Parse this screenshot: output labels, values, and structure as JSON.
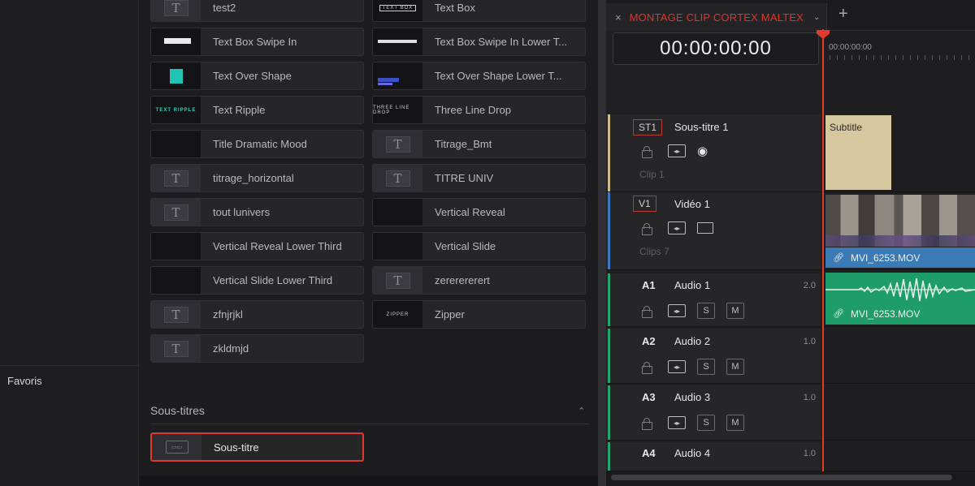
{
  "sidebar": {
    "favorites_label": "Favoris"
  },
  "library": {
    "titles_grid": [
      {
        "label": "test2",
        "thumb": "generic"
      },
      {
        "label": "Text Box",
        "thumb": "textbox",
        "thumb_text": "TEXT BOX"
      },
      {
        "label": "Text Box Swipe In",
        "thumb": "swipe"
      },
      {
        "label": "Text Box Swipe In Lower T...",
        "thumb": "swipelow"
      },
      {
        "label": "Text Over Shape",
        "thumb": "shape"
      },
      {
        "label": "Text Over Shape Lower T...",
        "thumb": "shapelow"
      },
      {
        "label": "Text Ripple",
        "thumb": "ripple",
        "thumb_text": "TEXT RIPPLE"
      },
      {
        "label": "Three Line Drop",
        "thumb": "threeline",
        "thumb_text": "THREE LINE DROP"
      },
      {
        "label": "Title Dramatic Mood",
        "thumb": "dark"
      },
      {
        "label": "Titrage_Bmt",
        "thumb": "generic"
      },
      {
        "label": "titrage_horizontal",
        "thumb": "generic"
      },
      {
        "label": "TITRE UNIV",
        "thumb": "generic"
      },
      {
        "label": "tout lunivers",
        "thumb": "generic"
      },
      {
        "label": "Vertical Reveal",
        "thumb": "dark"
      },
      {
        "label": "Vertical Reveal Lower Third",
        "thumb": "dark"
      },
      {
        "label": "Vertical Slide",
        "thumb": "dark"
      },
      {
        "label": "Vertical Slide Lower Third",
        "thumb": "dark"
      },
      {
        "label": "zererererert",
        "thumb": "generic"
      },
      {
        "label": "zfnjrjkl",
        "thumb": "generic"
      },
      {
        "label": "Zipper",
        "thumb": "zipper",
        "thumb_text": "ZIPPER"
      },
      {
        "label": "zkldmjd",
        "thumb": "generic"
      }
    ],
    "section_title": "Sous-titres",
    "section_chevron": "⌃",
    "subtitle_item": {
      "label": "Sous-titre"
    }
  },
  "timeline": {
    "tab_close": "×",
    "tab_title": "MONTAGE CLIP CORTEX MALTEX",
    "tab_chevron": "⌄",
    "tab_add": "+",
    "timecode": "00:00:00:00",
    "ruler_time": "00:00:00:00",
    "tracks": [
      {
        "id": "ST1",
        "name": "Sous-titre 1",
        "meta": "Clip 1",
        "color": "#cdbb8f"
      },
      {
        "id": "V1",
        "name": "Vidéo 1",
        "meta": "Clips 7",
        "color": "#3b78c2"
      },
      {
        "id": "A1",
        "name": "Audio 1",
        "vol": "2.0",
        "color": "#22a56e"
      },
      {
        "id": "A2",
        "name": "Audio 2",
        "vol": "1.0",
        "color": "#22a56e"
      },
      {
        "id": "A3",
        "name": "Audio 3",
        "vol": "1.0",
        "color": "#22a56e"
      },
      {
        "id": "A4",
        "name": "Audio 4",
        "vol": "1.0",
        "color": "#22a56e"
      }
    ],
    "solo_label": "S",
    "mute_label": "M",
    "clips": {
      "subtitle": "Subtitle",
      "video": "MVI_6253.MOV",
      "audio": "MVI_6253.MOV"
    }
  },
  "colors": {
    "accent_red": "#e53a30",
    "subtitle_clip": "#d6c79f",
    "video_clip": "#3a7ab5",
    "audio_clip": "#1e9c6a"
  }
}
